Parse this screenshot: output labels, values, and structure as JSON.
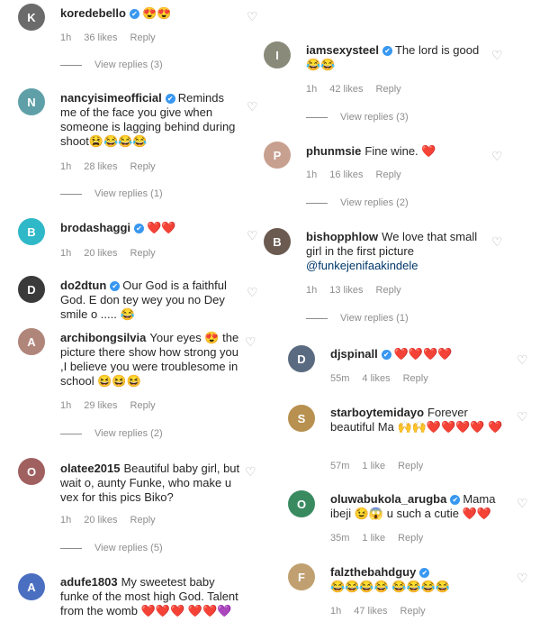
{
  "comments": [
    {
      "id": "c1",
      "user": "koredebello",
      "text": "",
      "emoji": "😍😍",
      "time": "1h",
      "likes": "36 likes",
      "reply": "Reply",
      "view": "View replies (3)",
      "avatar_color": "#6b6b6b",
      "initial": "K"
    },
    {
      "id": "c2",
      "user": "nancyisimeofficial",
      "text": "Reminds me of the face you give when someone is lagging behind during shoot",
      "emoji": "😫😂😂😂",
      "time": "1h",
      "likes": "28 likes",
      "reply": "Reply",
      "view": "View replies (1)",
      "avatar_color": "#5fa0a8",
      "initial": "N"
    },
    {
      "id": "c3",
      "user": "brodashaggi",
      "text": "",
      "emoji": "❤️❤️",
      "time": "1h",
      "likes": "20 likes",
      "reply": "Reply",
      "view": "",
      "avatar_color": "#2fb8c8",
      "initial": "B"
    },
    {
      "id": "c4",
      "user": "do2dtun",
      "text": "Our God is a faithful God. E don tey wey you no Dey smile o .....",
      "emoji": "😂",
      "time": "",
      "likes": "",
      "reply": "",
      "view": "",
      "avatar_color": "#3a3a3a",
      "initial": "D"
    },
    {
      "id": "c5",
      "user": "archibongsilvia",
      "text": "Your eyes",
      "emoji2": "😍 the picture there show how strong you ,I believe you were troublesome in school",
      "emoji3": "😆😆😆",
      "time": "1h",
      "likes": "29 likes",
      "reply": "Reply",
      "view": "View replies (2)",
      "avatar_color": "#b0857a",
      "initial": "A"
    },
    {
      "id": "c6",
      "user": "olatee2015",
      "text": "Beautiful baby girl, but wait o, aunty Funke, who make u vex for this pics Biko?",
      "emoji": "",
      "time": "1h",
      "likes": "20 likes",
      "reply": "Reply",
      "view": "View replies (5)",
      "avatar_color": "#a06060",
      "initial": "O"
    },
    {
      "id": "c7",
      "user": "adufe1803",
      "text": "My sweetest baby funke of the most high God. Talent from the womb",
      "emoji": "❤️❤️❤️ ❤️❤️💜",
      "time": "",
      "likes": "",
      "reply": "",
      "view": "",
      "avatar_color": "#4a6ec0",
      "initial": "A"
    },
    {
      "id": "c8",
      "user": "iamsexysteel",
      "text": "The lord is good",
      "emoji": "😂😂",
      "time": "1h",
      "likes": "42 likes",
      "reply": "Reply",
      "view": "View replies (3)",
      "avatar_color": "#8a8a7a",
      "initial": "I"
    },
    {
      "id": "c9",
      "user": "phunmsie",
      "text": "Fine wine.",
      "emoji": "❤️",
      "time": "1h",
      "likes": "16 likes",
      "reply": "Reply",
      "view": "View replies (2)",
      "avatar_color": "#c8a090",
      "initial": "P"
    },
    {
      "id": "c10",
      "user": "bishopphlow",
      "text": "We love that small girl in the first picture",
      "mention": "@funkejenifaakindele",
      "time": "1h",
      "likes": "13 likes",
      "reply": "Reply",
      "view": "View replies (1)",
      "avatar_color": "#6a5a50",
      "initial": "B"
    },
    {
      "id": "c11",
      "user": "djspinall",
      "text": "",
      "emoji": "❤️❤️❤️❤️",
      "time": "55m",
      "likes": "4 likes",
      "reply": "Reply",
      "view": "",
      "avatar_color": "#5a6a80",
      "initial": "D"
    },
    {
      "id": "c12",
      "user": "starboytemidayo",
      "text": "Forever beautiful Ma",
      "emoji": "🙌🙌❤️❤️❤️❤️ ❤️",
      "time": "57m",
      "likes": "1 like",
      "reply": "Reply",
      "view": "",
      "avatar_color": "#b89050",
      "initial": "S"
    },
    {
      "id": "c13",
      "user": "oluwabukola_arugba",
      "text": "Mama ibeji",
      "emoji1": "😉😱",
      "text2": "u such a cutie",
      "emoji2": "❤️❤️",
      "time": "35m",
      "likes": "1 like",
      "reply": "Reply",
      "view": "",
      "avatar_color": "#3a8a60",
      "initial": "O"
    },
    {
      "id": "c14",
      "user": "falzthebahdguy",
      "text": "",
      "emoji": "😂😂😂😂 😂😂😂😂",
      "time": "1h",
      "likes": "47 likes",
      "reply": "Reply",
      "view": "",
      "avatar_color": "#c0a070",
      "initial": "F"
    }
  ],
  "icons": {
    "heart": "heart-outline-icon",
    "verified": "verified-badge-icon"
  }
}
